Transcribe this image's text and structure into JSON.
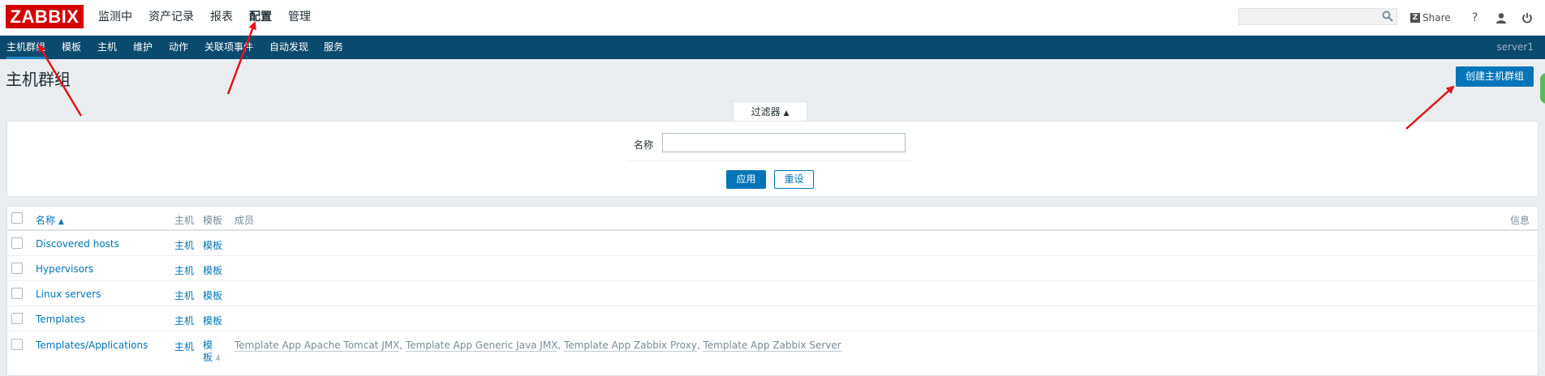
{
  "brand": {
    "logo_text": "ZABBIX",
    "accent": "#d40000"
  },
  "main_menu": {
    "items": [
      {
        "label": "监测中"
      },
      {
        "label": "资产记录"
      },
      {
        "label": "报表"
      },
      {
        "label": "配置",
        "selected": true
      },
      {
        "label": "管理"
      }
    ]
  },
  "search": {
    "value": "",
    "placeholder": "",
    "icon": "search-icon"
  },
  "header_actions": {
    "share_logo": "Z",
    "share_label": "Share",
    "help_glyph": "?",
    "help_icon": "help-icon",
    "profile_icon": "user-icon",
    "logout_icon": "power-icon"
  },
  "sub_menu": {
    "items": [
      {
        "label": "主机群组",
        "selected": true
      },
      {
        "label": "模板"
      },
      {
        "label": "主机"
      },
      {
        "label": "维护"
      },
      {
        "label": "动作"
      },
      {
        "label": "关联项事件"
      },
      {
        "label": "自动发现"
      },
      {
        "label": "服务"
      }
    ],
    "server_name": "server1",
    "background": "#0b4a6f"
  },
  "page": {
    "title": "主机群组",
    "create_button": "创建主机群组"
  },
  "filter": {
    "tab_label": "过滤器",
    "tab_arrow": "▲",
    "name_label": "名称",
    "name_value": "",
    "apply_button": "应用",
    "reset_button": "重设"
  },
  "table": {
    "columns": {
      "name": "名称",
      "name_sort_arrow": "▲",
      "hosts": "主机",
      "templates": "模板",
      "members": "成员",
      "info": "信息"
    },
    "rows": [
      {
        "name": "Discovered hosts",
        "hosts": "主机",
        "templates": "模板",
        "members": []
      },
      {
        "name": "Hypervisors",
        "hosts": "主机",
        "templates": "模板",
        "members": []
      },
      {
        "name": "Linux servers",
        "hosts": "主机",
        "templates": "模板",
        "members": []
      },
      {
        "name": "Templates",
        "hosts": "主机",
        "templates": "模板",
        "members": []
      },
      {
        "name": "Templates/Applications",
        "hosts": "主机",
        "templates_line1": "模",
        "templates_line2": "板",
        "templates_count": "4",
        "members": [
          "Template App Apache Tomcat JMX",
          "Template App Generic Java JMX",
          "Template App Zabbix Proxy",
          "Template App Zabbix Server"
        ],
        "member_separator": ", "
      }
    ]
  },
  "colors": {
    "primary": "#0275b8",
    "link": "#0275b8",
    "annotation_arrow": "#e0161a"
  }
}
